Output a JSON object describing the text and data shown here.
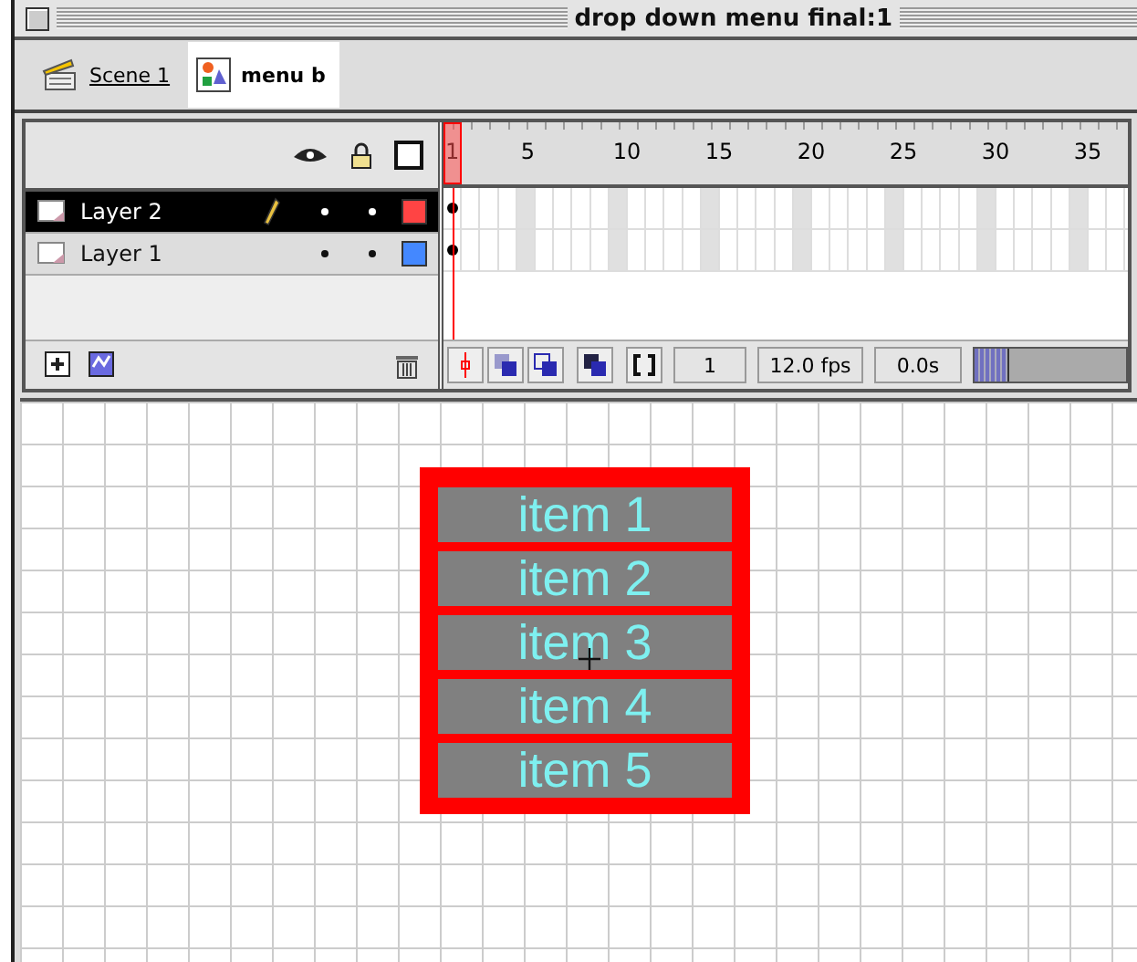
{
  "window": {
    "title": "drop down menu final:1"
  },
  "breadcrumb": [
    {
      "label": "Scene 1",
      "kind": "scene",
      "selected": false
    },
    {
      "label": "menu b",
      "kind": "symbol",
      "selected": true
    }
  ],
  "timeline": {
    "ruler": [
      "1",
      "5",
      "10",
      "15",
      "20",
      "25",
      "30",
      "35"
    ],
    "layers": [
      {
        "name": "Layer 2",
        "selected": true,
        "editing": true,
        "color": "#ff4444"
      },
      {
        "name": "Layer 1",
        "selected": false,
        "editing": false,
        "color": "#4488ff"
      }
    ],
    "current_frame": "1",
    "frame_rate": "12.0 fps",
    "elapsed": "0.0s"
  },
  "stage": {
    "menu_items": [
      "item 1",
      "item 2",
      "item 3",
      "item 4",
      "item 5"
    ]
  }
}
